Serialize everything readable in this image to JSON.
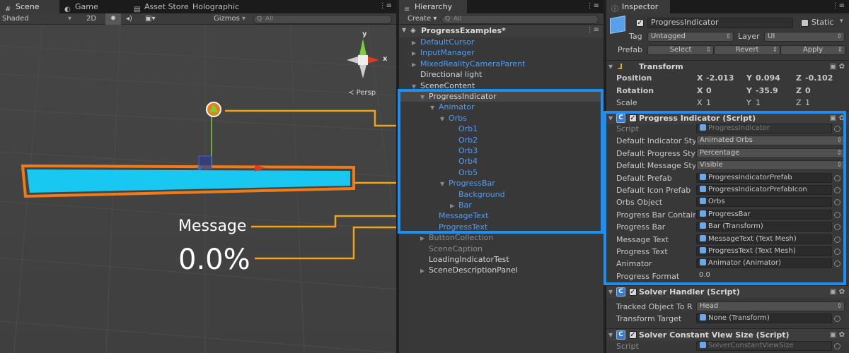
{
  "scene": {
    "tabs": [
      {
        "label": "Scene",
        "icon": "scene-icon"
      },
      {
        "label": "Game",
        "icon": "game-icon"
      },
      {
        "label": "Asset Store",
        "icon": "store-icon"
      },
      {
        "label": "Holographic",
        "icon": ""
      }
    ],
    "shading": "Shaded",
    "mode_2d": "2D",
    "gizmos": "Gizmos",
    "search_placeholder": "All",
    "persp": "Persp",
    "gizmo_axes": {
      "y": "y",
      "x": "x"
    },
    "overlay_message": "Message",
    "overlay_percent": "0.0%"
  },
  "hierarchy": {
    "tab": "Hierarchy",
    "create": "Create",
    "search_placeholder": "All",
    "root": "ProgressExamples*",
    "items": [
      {
        "label": "DefaultCursor",
        "style": "blue",
        "arrow": "▶"
      },
      {
        "label": "InputManager",
        "style": "blue",
        "arrow": "▶"
      },
      {
        "label": "MixedRealityCameraParent",
        "style": "blue",
        "arrow": "▶"
      },
      {
        "label": "Directional light",
        "style": "white",
        "arrow": ""
      },
      {
        "label": "SceneContent",
        "style": "white",
        "arrow": "▼"
      },
      {
        "label": "ProgressIndicator",
        "style": "white",
        "arrow": "▼"
      },
      {
        "label": "Animator",
        "style": "blue",
        "arrow": "▼"
      },
      {
        "label": "Orbs",
        "style": "blue",
        "arrow": "▼"
      },
      {
        "label": "Orb1",
        "style": "blue",
        "arrow": ""
      },
      {
        "label": "Orb2",
        "style": "blue",
        "arrow": ""
      },
      {
        "label": "Orb3",
        "style": "blue",
        "arrow": ""
      },
      {
        "label": "Orb4",
        "style": "blue",
        "arrow": ""
      },
      {
        "label": "Orb5",
        "style": "blue",
        "arrow": ""
      },
      {
        "label": "ProgressBar",
        "style": "blue",
        "arrow": "▼"
      },
      {
        "label": "Background",
        "style": "blue",
        "arrow": ""
      },
      {
        "label": "Bar",
        "style": "blue",
        "arrow": "▶"
      },
      {
        "label": "MessageText",
        "style": "blue",
        "arrow": ""
      },
      {
        "label": "ProgressText",
        "style": "blue",
        "arrow": ""
      },
      {
        "label": "ButtonCollection",
        "style": "grey",
        "arrow": "▶"
      },
      {
        "label": "SceneCaption",
        "style": "grey",
        "arrow": ""
      },
      {
        "label": "LoadingIndicatorTest",
        "style": "white",
        "arrow": ""
      },
      {
        "label": "SceneDescriptionPanel",
        "style": "white",
        "arrow": "▶"
      }
    ]
  },
  "inspector": {
    "tab": "Inspector",
    "object_name": "ProgressIndicator",
    "static_label": "Static",
    "tag_label": "Tag",
    "tag_value": "Untagged",
    "layer_label": "Layer",
    "layer_value": "UI",
    "prefab_label": "Prefab",
    "prefab_buttons": [
      "Select",
      "Revert",
      "Apply"
    ],
    "transform": {
      "title": "Transform",
      "rows": [
        {
          "label": "Position",
          "x": "-2.013",
          "y": "0.094",
          "z": "-0.102"
        },
        {
          "label": "Rotation",
          "x": "0",
          "y": "-35.9",
          "z": "0"
        },
        {
          "label": "Scale",
          "x": "1",
          "y": "1",
          "z": "1"
        }
      ],
      "axes": [
        "X",
        "Y",
        "Z"
      ]
    },
    "progress_script": {
      "title": "Progress Indicator (Script)",
      "rows": [
        {
          "label": "Script",
          "value": "ProgressIndicator",
          "kind": "ref-disabled"
        },
        {
          "label": "Default Indicator Sty",
          "value": "Animated Orbs",
          "kind": "drop"
        },
        {
          "label": "Default Progress Sty",
          "value": "Percentage",
          "kind": "drop"
        },
        {
          "label": "Default Message Sty",
          "value": "Visible",
          "kind": "drop"
        },
        {
          "label": "Default Prefab",
          "value": "ProgressIndicatorPrefab",
          "kind": "ref"
        },
        {
          "label": "Default Icon Prefab",
          "value": "ProgressIndicatorPrefabIcon",
          "kind": "ref"
        },
        {
          "label": "Orbs Object",
          "value": "Orbs",
          "kind": "ref"
        },
        {
          "label": "Progress Bar Contair",
          "value": "ProgressBar",
          "kind": "ref"
        },
        {
          "label": "Progress Bar",
          "value": "Bar (Transform)",
          "kind": "ref"
        },
        {
          "label": "Message Text",
          "value": "MessageText (Text Mesh)",
          "kind": "ref"
        },
        {
          "label": "Progress Text",
          "value": "ProgressText (Text Mesh)",
          "kind": "ref"
        },
        {
          "label": "Animator",
          "value": "Animator (Animator)",
          "kind": "ref"
        },
        {
          "label": "Progress Format",
          "value": "0.0",
          "kind": "text"
        }
      ]
    },
    "solver_handler": {
      "title": "Solver Handler (Script)",
      "rows": [
        {
          "label": "Tracked Object To R",
          "value": "Head",
          "kind": "drop"
        },
        {
          "label": "Transform Target",
          "value": "None (Transform)",
          "kind": "ref"
        }
      ]
    },
    "solver_view": {
      "title": "Solver Constant View Size (Script)",
      "rows": [
        {
          "label": "Script",
          "value": "SolverConstantViewSize",
          "kind": "ref-disabled"
        }
      ]
    }
  },
  "colors": {
    "highlight": "#1f8ef3",
    "callout": "#f0a418",
    "bar_fill": "#19c8f0",
    "bar_outline": "#f07a18",
    "link_blue": "#4f9df4"
  }
}
